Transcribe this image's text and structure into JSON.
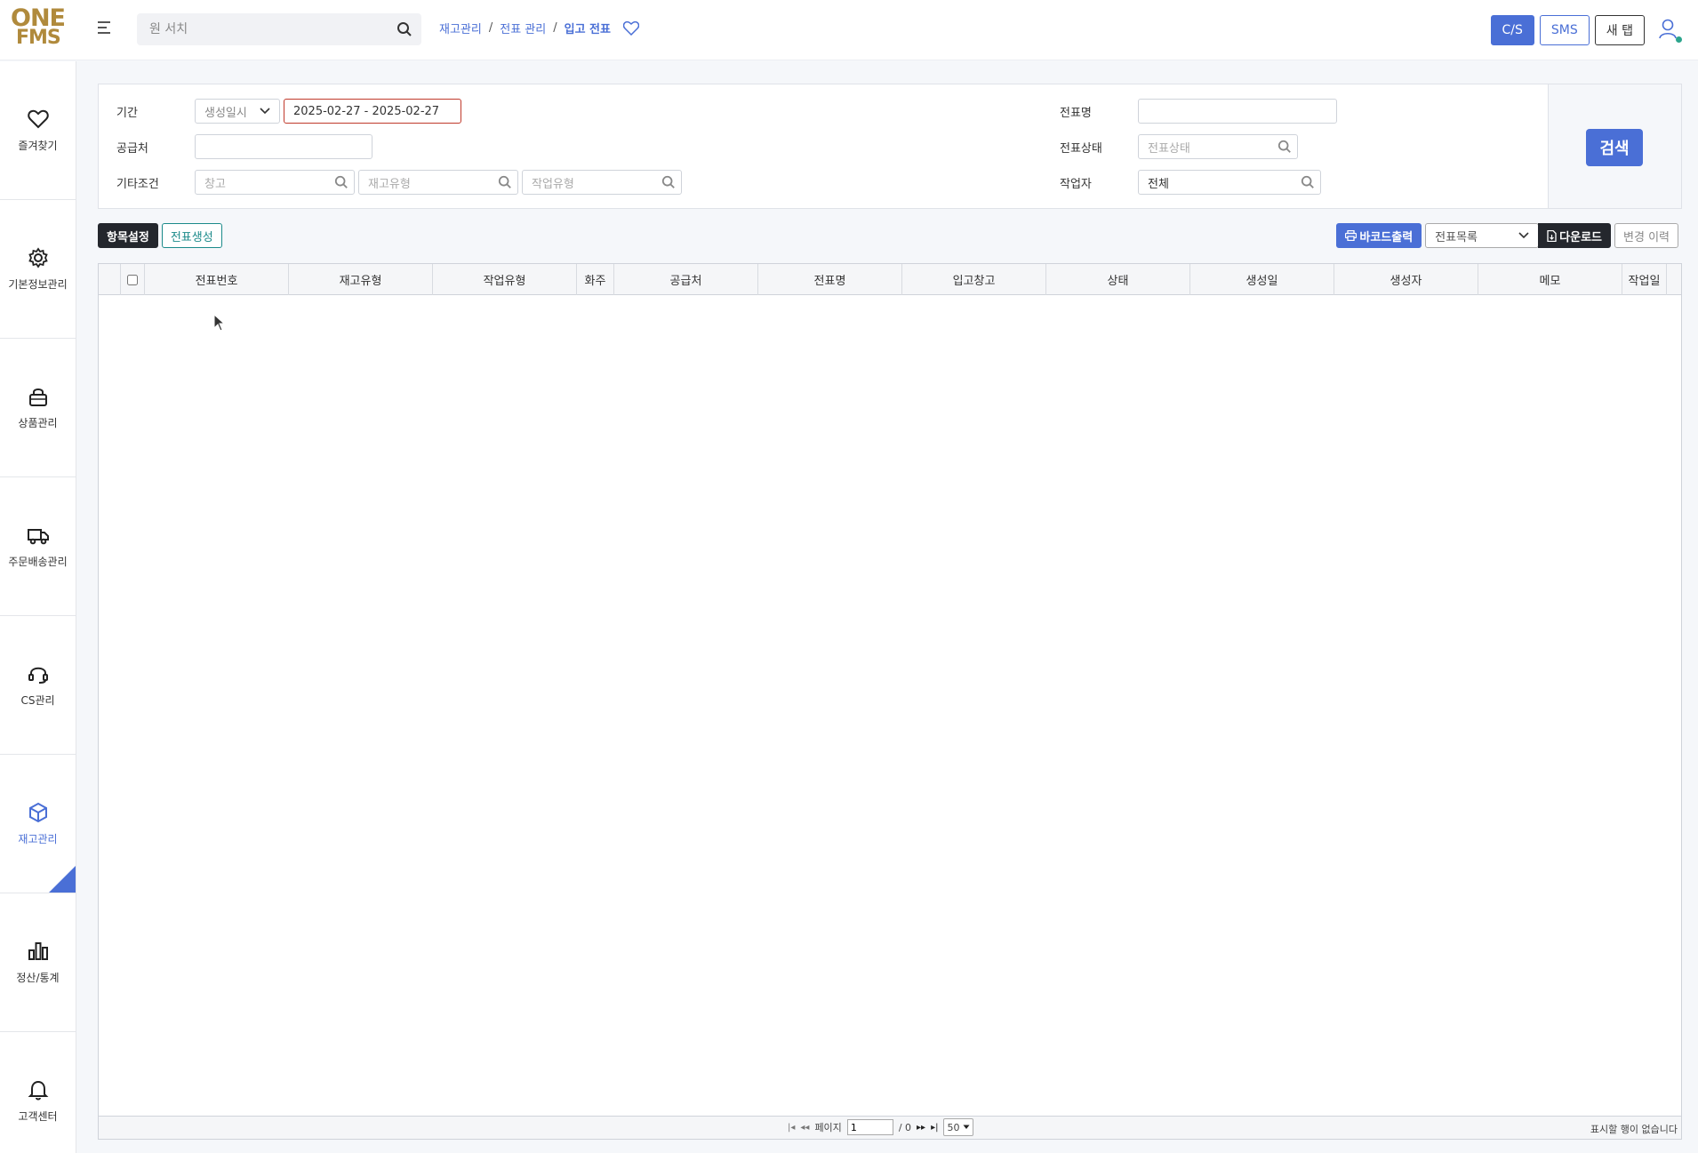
{
  "header": {
    "logo_line1": "ONE",
    "logo_line2": "FMS",
    "search_placeholder": "원 서치",
    "breadcrumb": [
      "재고관리",
      "전표 관리",
      "입고 전표"
    ],
    "buttons": [
      "C/S",
      "SMS",
      "새 탭"
    ]
  },
  "sidebar": {
    "items": [
      {
        "label": "즐겨찾기",
        "icon": "heart-icon"
      },
      {
        "label": "기본정보관리",
        "icon": "gear-icon"
      },
      {
        "label": "상품관리",
        "icon": "bag-icon"
      },
      {
        "label": "주문배송관리",
        "icon": "truck-icon"
      },
      {
        "label": "CS관리",
        "icon": "headset-icon"
      },
      {
        "label": "재고관리",
        "icon": "box-icon",
        "active": true
      },
      {
        "label": "정산/통계",
        "icon": "bar-chart-icon"
      },
      {
        "label": "고객센터",
        "icon": "bell-icon"
      }
    ]
  },
  "filter": {
    "period_label": "기간",
    "period_type": "생성일시",
    "period_value": "2025-02-27 - 2025-02-27",
    "supplier_label": "공급처",
    "supplier_value": "",
    "etc_label": "기타조건",
    "warehouse_placeholder": "창고",
    "stock_type_placeholder": "재고유형",
    "work_type_placeholder": "작업유형",
    "slip_name_label": "전표명",
    "slip_name_value": "",
    "slip_status_label": "전표상태",
    "slip_status_placeholder": "전표상태",
    "worker_label": "작업자",
    "worker_value": "전체",
    "search_button": "검색"
  },
  "toolbar": {
    "column_settings": "항목설정",
    "create_slip": "전표생성",
    "barcode_print": "바코드출력",
    "list_select": "전표목록",
    "download": "다운로드",
    "change_history": "변경 이력"
  },
  "grid": {
    "columns": [
      "전표번호",
      "재고유형",
      "작업유형",
      "화주",
      "공급처",
      "전표명",
      "입고창고",
      "상태",
      "생성일",
      "생성자",
      "메모",
      "작업일"
    ],
    "rows": []
  },
  "pager": {
    "page_label": "페이지",
    "page_value": "1",
    "total_pages": "/ 0",
    "page_size": "50",
    "no_rows": "표시할 행이 없습니다"
  },
  "colors": {
    "accent": "#4a6fd6",
    "brand_logo": "#b08a3c",
    "teal": "#1b8a8a",
    "dark": "#24272d",
    "error_border": "#c0392b"
  }
}
